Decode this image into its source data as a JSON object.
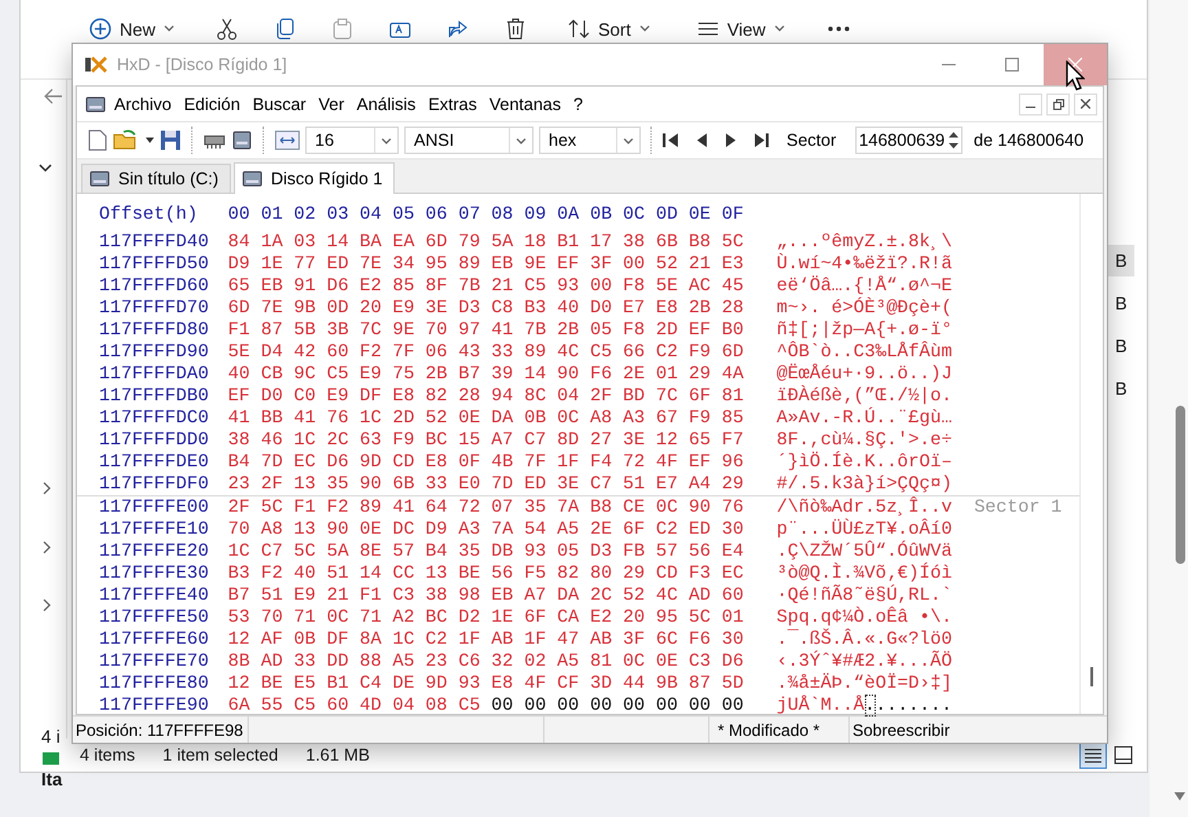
{
  "explorer": {
    "toolbar": {
      "new": "New",
      "sort": "Sort",
      "view": "View"
    },
    "left_fragments": [
      {
        "text": "4 i",
        "kind": "plain"
      },
      {
        "text": "Ita",
        "kind": "file"
      }
    ],
    "right_fragments": [
      {
        "text": "B",
        "selected": true
      },
      {
        "text": "B",
        "selected": false
      },
      {
        "text": "B",
        "selected": false
      },
      {
        "text": "B",
        "selected": false
      }
    ],
    "status": [
      "4 items",
      "1 item selected",
      "1.61 MB"
    ]
  },
  "hxd": {
    "window": {
      "title": "HxD - [Disco Rígido 1]",
      "close_hovered": true
    },
    "menu": [
      "Archivo",
      "Edición",
      "Buscar",
      "Ver",
      "Análisis",
      "Extras",
      "Ventanas",
      "?"
    ],
    "toolbar": {
      "bytes_per_row": "16",
      "charset": "ANSI",
      "display": "hex",
      "sector_label": "Sector",
      "sector_value": "146800639",
      "sector_total": "de 146800640"
    },
    "tabs": [
      {
        "label": "Sin título (C:)",
        "selected": false
      },
      {
        "label": "Disco Rígido 1",
        "selected": true
      }
    ],
    "hex": {
      "offset_header": "Offset(h)",
      "columns": [
        "00",
        "01",
        "02",
        "03",
        "04",
        "05",
        "06",
        "07",
        "08",
        "09",
        "0A",
        "0B",
        "0C",
        "0D",
        "0E",
        "0F"
      ],
      "rows": [
        {
          "offset": "117FFFFD40",
          "modified_hex": "84 1A 03 14 BA EA 6D 79 5A 18 B1 17 38 6B B8 5C",
          "modified_ascii": "„...ºêmyZ.±.8k¸\\"
        },
        {
          "offset": "117FFFFD50",
          "modified_hex": "D9 1E 77 ED 7E 34 95 89 EB 9E EF 3F 00 52 21 E3",
          "modified_ascii": "Ù.wí~4•‰ëžï?.R!ã"
        },
        {
          "offset": "117FFFFD60",
          "modified_hex": "65 EB 91 D6 E2 85 8F 7B 21 C5 93 00 F8 5E AC 45",
          "modified_ascii": "eë‘Öâ….{!Å“.ø^¬E"
        },
        {
          "offset": "117FFFFD70",
          "modified_hex": "6D 7E 9B 0D 20 E9 3E D3 C8 B3 40 D0 E7 E8 2B 28",
          "modified_ascii": "m~›. é>ÓÈ³@Ðçè+("
        },
        {
          "offset": "117FFFFD80",
          "modified_hex": "F1 87 5B 3B 7C 9E 70 97 41 7B 2B 05 F8 2D EF B0",
          "modified_ascii": "ñ‡[;|žp—A{+.ø-ï°"
        },
        {
          "offset": "117FFFFD90",
          "modified_hex": "5E D4 42 60 F2 7F 06 43 33 89 4C C5 66 C2 F9 6D",
          "modified_ascii": "^ÔB`ò..C3‰LÅfÂùm"
        },
        {
          "offset": "117FFFFDA0",
          "modified_hex": "40 CB 9C C5 E9 75 2B B7 39 14 90 F6 2E 01 29 4A",
          "modified_ascii": "@ËœÅéu+·9..ö..)J"
        },
        {
          "offset": "117FFFFDB0",
          "modified_hex": "EF D0 C0 E9 DF E8 82 28 94 8C 04 2F BD 7C 6F 81",
          "modified_ascii": "ïÐÀéßè‚(”Œ./½|o."
        },
        {
          "offset": "117FFFFDC0",
          "modified_hex": "41 BB 41 76 1C 2D 52 0E DA 0B 0C A8 A3 67 F9 85",
          "modified_ascii": "A»Av.-R.Ú..¨£gù…"
        },
        {
          "offset": "117FFFFDD0",
          "modified_hex": "38 46 1C 2C 63 F9 BC 15 A7 C7 8D 27 3E 12 65 F7",
          "modified_ascii": "8F.,cù¼.§Ç.'>.e÷"
        },
        {
          "offset": "117FFFFDE0",
          "modified_hex": "B4 7D EC D6 9D CD E8 0F 4B 7F 1F F4 72 4F EF 96",
          "modified_ascii": "´}ìÖ.Íè.K..ôrOï–"
        },
        {
          "offset": "117FFFFDF0",
          "modified_hex": "23 2F 13 35 90 6B 33 E0 7D ED 3E C7 51 E7 A4 29",
          "modified_ascii": "#/.5.k3à}í>ÇQç¤)"
        },
        {
          "offset": "117FFFFE00",
          "modified_hex": "2F 5C F1 F2 89 41 64 72 07 35 7A B8 CE 0C 90 76",
          "modified_ascii": "/\\ñò‰Adr.5z¸Î..v",
          "sector_label": "Sector 1"
        },
        {
          "offset": "117FFFFE10",
          "modified_hex": "70 A8 13 90 0E DC D9 A3 7A 54 A5 2E 6F C2 ED 30",
          "modified_ascii": "p¨...ÜÙ£zT¥.oÂí0"
        },
        {
          "offset": "117FFFFE20",
          "modified_hex": "1C C7 5C 5A 8E 57 B4 35 DB 93 05 D3 FB 57 56 E4",
          "modified_ascii": ".Ç\\ZŽW´5Û“.ÓûWVä"
        },
        {
          "offset": "117FFFFE30",
          "modified_hex": "B3 F2 40 51 14 CC 13 BE 56 F5 82 80 29 CD F3 EC",
          "modified_ascii": "³ò@Q.Ì.¾Võ‚€)Íóì"
        },
        {
          "offset": "117FFFFE40",
          "modified_hex": "B7 51 E9 21 F1 C3 38 98 EB A7 DA 2C 52 4C AD 60",
          "modified_ascii": "·Qé!ñÃ8˜ë§Ú,RL.`"
        },
        {
          "offset": "117FFFFE50",
          "modified_hex": "53 70 71 0C 71 A2 BC D2 1E 6F CA E2 20 95 5C 01",
          "modified_ascii": "Spq.q¢¼Ò.oÊâ •\\."
        },
        {
          "offset": "117FFFFE60",
          "modified_hex": "12 AF 0B DF 8A 1C C2 1F AB 1F 47 AB 3F 6C F6 30",
          "modified_ascii": ".¯.ßŠ.Â.«.G«?lö0"
        },
        {
          "offset": "117FFFFE70",
          "modified_hex": "8B AD 33 DD 88 A5 23 C6 32 02 A5 81 0C 0E C3 D6",
          "modified_ascii": "‹.3Ýˆ¥#Æ2.¥...ÃÖ"
        },
        {
          "offset": "117FFFFE80",
          "modified_hex": "12 BE E5 B1 C4 DE 9D 93 E8 4F CF 3D 44 9B 87 5D",
          "modified_ascii": ".¾å±ÄÞ.“èOÏ=D›‡]"
        },
        {
          "offset": "117FFFFE90",
          "modified_hex": "6A 55 C5 60 4D 04 08 C5",
          "hex": "00 00 00 00 00 00 00 00",
          "modified_ascii": "jUÅ`M..Å",
          "ascii_cursor": ".",
          "ascii": "......."
        }
      ]
    },
    "status_bar": {
      "position": "Posición: 117FFFFE98",
      "modified": "* Modificado *",
      "mode": "Sobreescribir"
    }
  }
}
